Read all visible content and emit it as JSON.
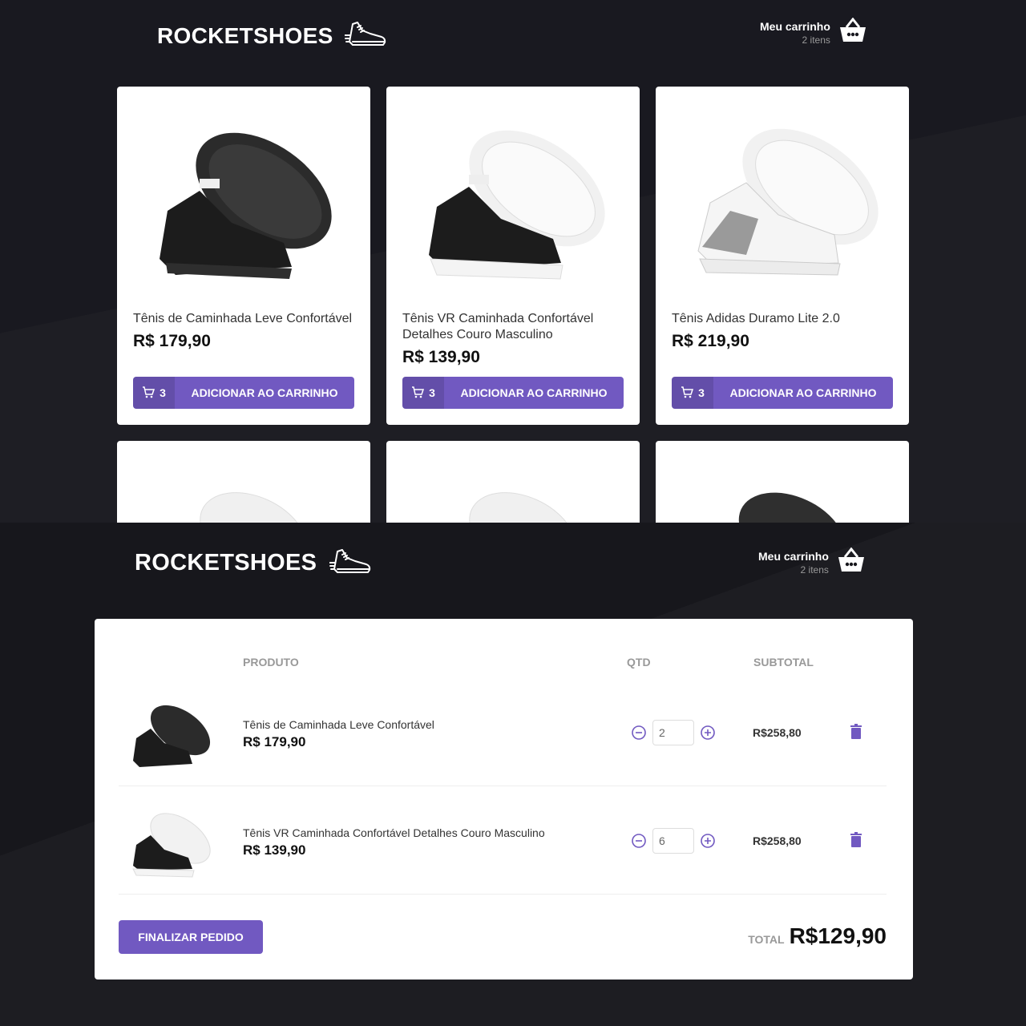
{
  "colors": {
    "accent": "#7159c1",
    "background": "#191920",
    "card": "#ffffff"
  },
  "header": {
    "logo": "ROCKETSHOES",
    "logo_icon": "sneaker-icon",
    "cart_title": "Meu carrinho",
    "cart_count": "2 itens",
    "cart_icon": "basket-icon"
  },
  "products": [
    {
      "title": "Tênis de Caminhada Leve Confortável",
      "price": "R$ 179,90",
      "cart_qty": "3",
      "button": "ADICIONAR AO CARRINHO",
      "shoe": "black"
    },
    {
      "title": "Tênis VR Caminhada Confortável Detalhes Couro Masculino",
      "price": "R$ 139,90",
      "cart_qty": "3",
      "button": "ADICIONAR AO CARRINHO",
      "shoe": "black-white"
    },
    {
      "title": "Tênis Adidas Duramo Lite 2.0",
      "price": "R$ 219,90",
      "cart_qty": "3",
      "button": "ADICIONAR AO CARRINHO",
      "shoe": "white-grey"
    }
  ],
  "cart": {
    "headers": {
      "product": "PRODUTO",
      "qty": "QTD",
      "subtotal": "SUBTOTAL"
    },
    "items": [
      {
        "title": "Tênis de Caminhada Leve Confortável",
        "price": "R$ 179,90",
        "qty": "2",
        "subtotal": "R$258,80",
        "shoe": "black"
      },
      {
        "title": "Tênis VR Caminhada Confortável Detalhes Couro Masculino",
        "price": "R$ 139,90",
        "qty": "6",
        "subtotal": "R$258,80",
        "shoe": "black-white"
      }
    ],
    "finish_button": "FINALIZAR PEDIDO",
    "total_label": "TOTAL",
    "total_value": "R$129,90"
  }
}
